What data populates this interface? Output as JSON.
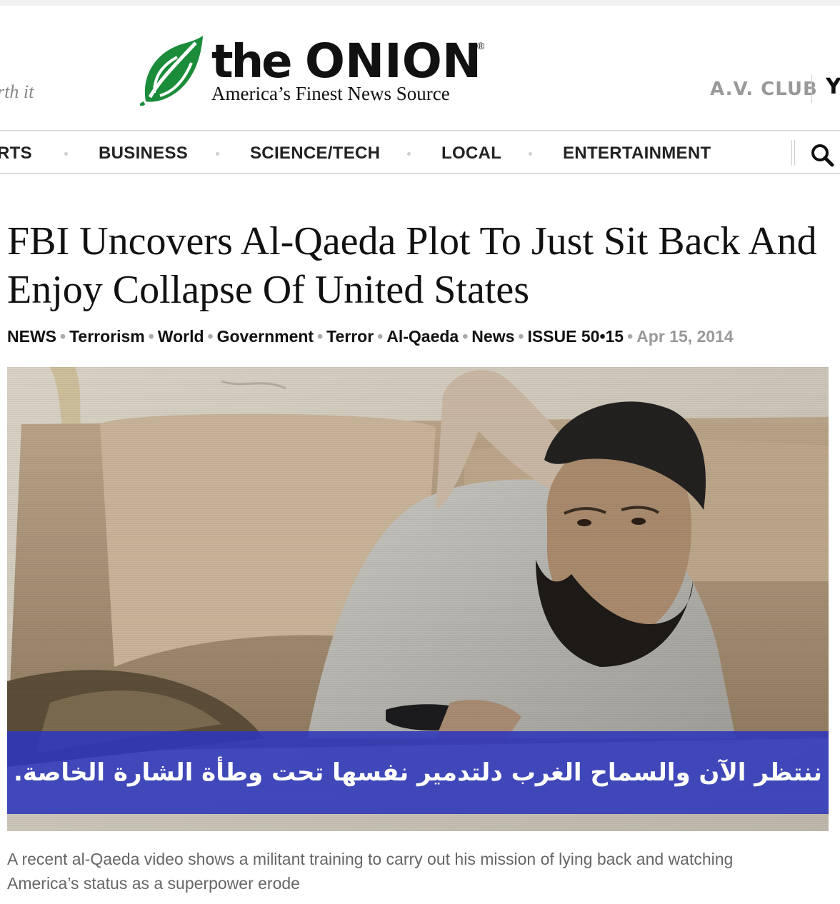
{
  "header": {
    "left_tagline": "rth it",
    "logo": {
      "word_the": "the",
      "word_onion": "ONION",
      "registered": "®",
      "tagline": "America’s Finest News Source",
      "color": "#1a8c3a"
    },
    "right_link": "A.V. CLUB",
    "right_cut": "Yo"
  },
  "nav": {
    "items": [
      {
        "label": "RTS"
      },
      {
        "label": "BUSINESS"
      },
      {
        "label": "SCIENCE/TECH"
      },
      {
        "label": "LOCAL"
      },
      {
        "label": "ENTERTAINMENT"
      }
    ],
    "search_icon": "search-icon"
  },
  "article": {
    "headline": "FBI Uncovers Al-Qaeda Plot To Just Sit Back And Enjoy Collapse Of United States",
    "tags": {
      "section": "NEWS",
      "items": [
        "Terrorism",
        "World",
        "Government",
        "Terror",
        "Al-Qaeda",
        "News"
      ],
      "issue": "ISSUE 50•15",
      "date": "Apr 15, 2014"
    },
    "image": {
      "subtitle": "ننتظر الآن والسماح الغرب دلتدمير نفسها تحت وطأة الشارة الخاصة.",
      "subtitle_bar_color": "#2d37b9"
    },
    "caption": "A recent al-Qaeda video shows a militant training to carry out his mission of lying back and watching America’s status as a superpower erode"
  }
}
